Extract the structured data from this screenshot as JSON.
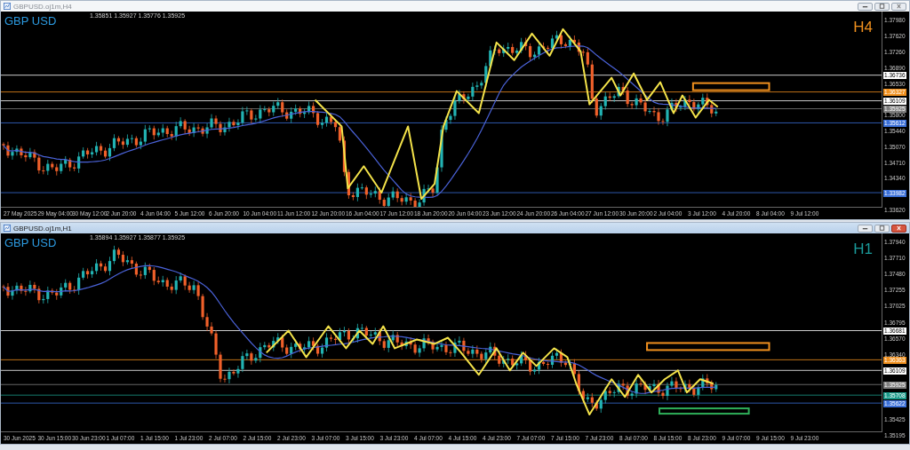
{
  "charts": [
    {
      "title": "GBPUSD.oj1m,H4",
      "active": false,
      "symbol": "GBP USD",
      "ohlc": "1.35851 1.35927 1.35776 1.35925",
      "timeframe": "H4",
      "price_ticks": [
        "1.37980",
        "1.37620",
        "1.37260",
        "1.36890",
        "1.36530",
        "1.35800",
        "1.35440",
        "1.35070",
        "1.34710",
        "1.34340",
        "1.33620"
      ],
      "price_levels": [
        {
          "label": "1.36736",
          "color": "#ffffff"
        },
        {
          "label": "1.36327",
          "color": "#f0901e"
        },
        {
          "label": "1.36109",
          "color": "#ffffff"
        },
        {
          "label": "1.35925",
          "color": "#7f7f7f"
        },
        {
          "label": "1.35612",
          "color": "#3a6fd8"
        },
        {
          "label": "1.33982",
          "color": "#3a6fd8"
        }
      ],
      "time_labels": [
        "27 May 2025",
        "29 May 04:00",
        "30 May 12:00",
        "2 Jun 20:00",
        "4 Jun 04:00",
        "5 Jun 12:00",
        "6 Jun 20:00",
        "10 Jun 04:00",
        "11 Jun 12:00",
        "12 Jun 20:00",
        "16 Jun 04:00",
        "17 Jun 12:00",
        "18 Jun 20:00",
        "20 Jun 04:00",
        "23 Jun 12:00",
        "24 Jun 20:00",
        "26 Jun 04:00",
        "27 Jun 12:00",
        "30 Jun 20:00",
        "2 Jul 04:00",
        "3 Jul 12:00",
        "4 Jul 20:00",
        "8 Jul 04:00",
        "9 Jul 12:00"
      ]
    },
    {
      "title": "GBPUSD.oj1m,H1",
      "active": true,
      "symbol": "GBP USD",
      "ohlc": "1.35894 1.35927 1.35877 1.35925",
      "timeframe": "H1",
      "price_ticks": [
        "1.37940",
        "1.37710",
        "1.37480",
        "1.37255",
        "1.37025",
        "1.36795",
        "1.36570",
        "1.36340",
        "1.35425",
        "1.35195"
      ],
      "price_levels": [
        {
          "label": "1.36681",
          "color": "#ffffff"
        },
        {
          "label": "1.36363",
          "color": "#f0901e"
        },
        {
          "label": "1.36109",
          "color": "#ffffff"
        },
        {
          "label": "1.35925",
          "color": "#7f7f7f"
        },
        {
          "label": "1.35708",
          "color": "#1a9a8a"
        },
        {
          "label": "1.35622",
          "color": "#3a6fd8"
        }
      ],
      "time_labels": [
        "30 Jun 2025",
        "30 Jun 15:00",
        "30 Jun 23:00",
        "1 Jul 07:00",
        "1 Jul 15:00",
        "1 Jul 23:00",
        "2 Jul 07:00",
        "2 Jul 15:00",
        "2 Jul 23:00",
        "3 Jul 07:00",
        "3 Jul 15:00",
        "3 Jul 23:00",
        "4 Jul 07:00",
        "4 Jul 15:00",
        "4 Jul 23:00",
        "7 Jul 07:00",
        "7 Jul 15:00",
        "7 Jul 23:00",
        "8 Jul 07:00",
        "8 Jul 15:00",
        "8 Jul 23:00",
        "9 Jul 07:00",
        "9 Jul 15:00",
        "9 Jul 23:00"
      ]
    }
  ]
}
